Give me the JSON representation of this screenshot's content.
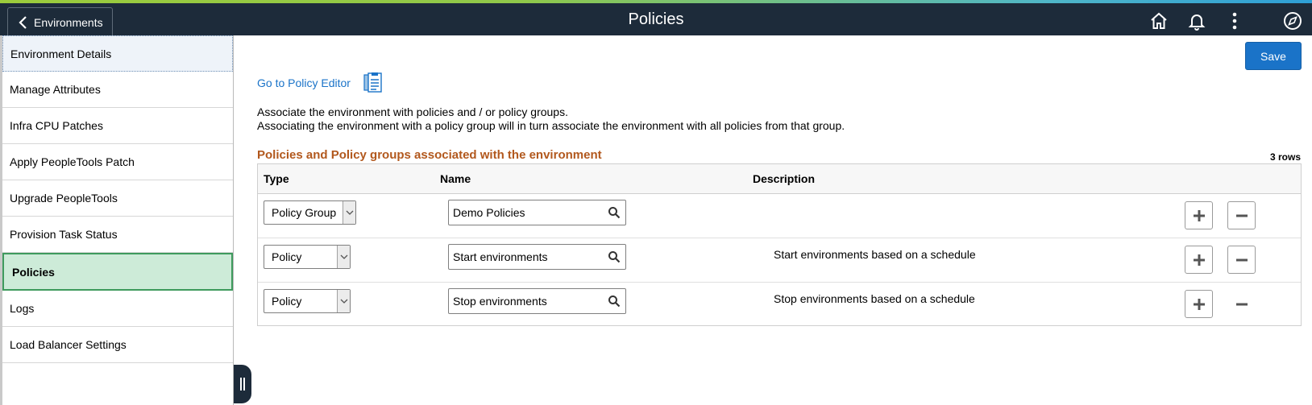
{
  "header": {
    "back_label": "Environments",
    "title": "Policies"
  },
  "sidebar": {
    "items": [
      {
        "label": "Environment Details"
      },
      {
        "label": "Manage Attributes"
      },
      {
        "label": "Infra CPU Patches"
      },
      {
        "label": "Apply PeopleTools Patch"
      },
      {
        "label": "Upgrade PeopleTools"
      },
      {
        "label": "Provision Task Status"
      },
      {
        "label": "Policies"
      },
      {
        "label": "Logs"
      },
      {
        "label": "Load Balancer Settings"
      }
    ]
  },
  "main": {
    "save_label": "Save",
    "policy_editor_link": "Go to Policy Editor",
    "description_line1": "Associate the environment with policies and / or policy groups.",
    "description_line2": "Associating the environment with a policy group will in turn associate the environment with all policies from that group.",
    "grid": {
      "title": "Policies and Policy groups associated with the environment",
      "row_count": "3 rows",
      "columns": {
        "type": "Type",
        "name": "Name",
        "description": "Description"
      },
      "rows": [
        {
          "type": "Policy Group",
          "name": "Demo Policies",
          "description": ""
        },
        {
          "type": "Policy",
          "name": "Start environments",
          "description": "Start environments based on a schedule"
        },
        {
          "type": "Policy",
          "name": "Stop environments",
          "description": "Stop environments based on a schedule"
        }
      ]
    }
  },
  "colors": {
    "header_bg": "#1d2b3a",
    "accent_blue": "#1a73c8",
    "grid_title": "#b2581d",
    "active_item_bg": "#cdebd8",
    "active_item_border": "#3e9a5d"
  }
}
